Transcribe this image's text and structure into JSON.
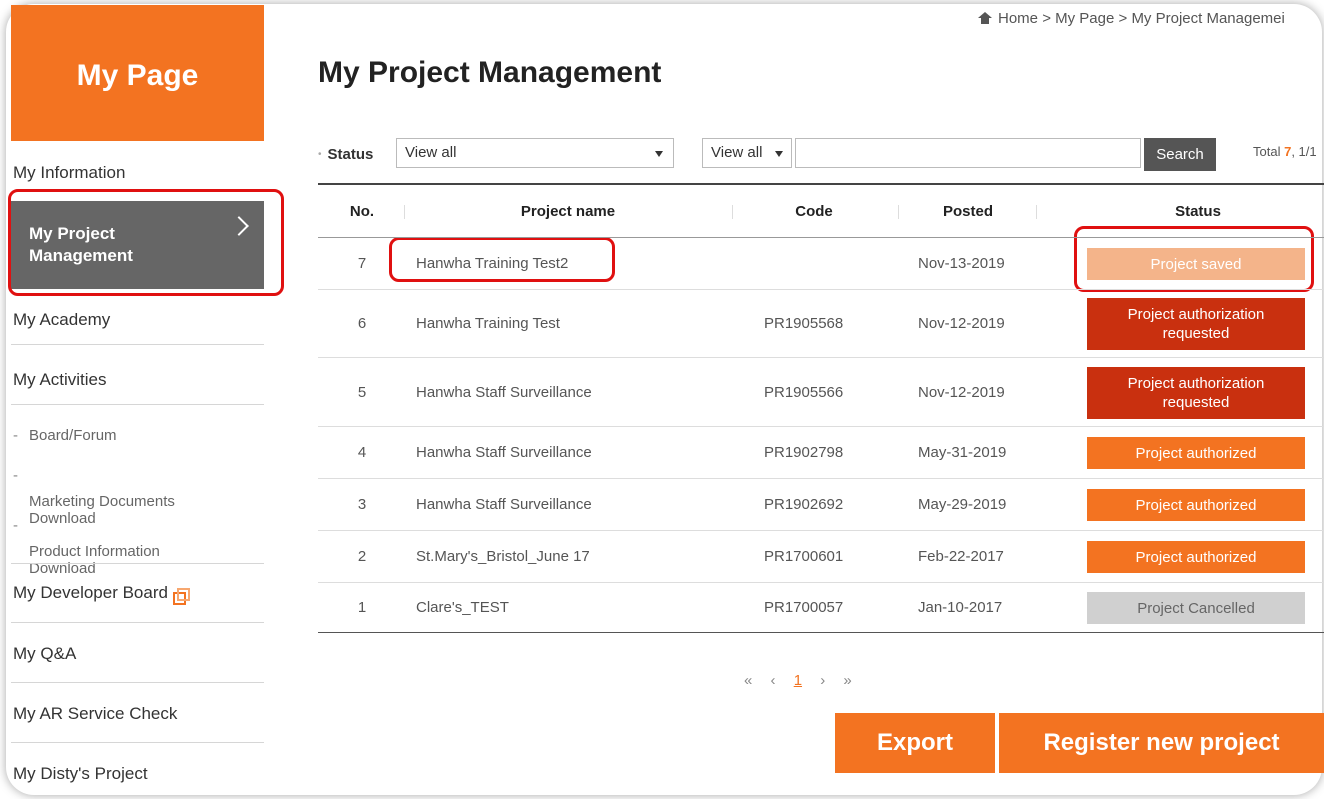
{
  "sidebar": {
    "header": "My Page",
    "items": [
      {
        "label": "My Information"
      },
      {
        "label": "My Project\nManagement"
      },
      {
        "label": "My Academy"
      },
      {
        "label": "My Activities"
      },
      {
        "label": "My Developer Board"
      },
      {
        "label": "My Q&A"
      },
      {
        "label": "My AR Service Check"
      },
      {
        "label": "My Disty's Project"
      }
    ],
    "sub_items": [
      {
        "label": "Board/Forum"
      },
      {
        "label": "Marketing Documents\nDownload"
      },
      {
        "label": "Product Information\nDownload"
      }
    ]
  },
  "breadcrumb": {
    "home": "Home",
    "sep": ">",
    "level1": "My Page",
    "level2": "My Project Managemei"
  },
  "page_title": "My Project Management",
  "filter": {
    "status_label": "Status",
    "status_value": "View all",
    "type_value": "View all",
    "search_value": "",
    "search_button": "Search",
    "total_prefix": "Total",
    "total_count": "7",
    "total_suffix": ", 1/1"
  },
  "table": {
    "headers": {
      "no": "No.",
      "name": "Project name",
      "code": "Code",
      "posted": "Posted",
      "status": "Status"
    },
    "rows": [
      {
        "no": "7",
        "name": "Hanwha Training Test2",
        "code": "",
        "posted": "Nov-13-2019",
        "status": "Project saved",
        "status_color": "#f4b48a"
      },
      {
        "no": "6",
        "name": "Hanwha Training Test",
        "code": "PR1905568",
        "posted": "Nov-12-2019",
        "status": "Project authorization requested",
        "status_color": "#c9300f"
      },
      {
        "no": "5",
        "name": "Hanwha Staff Surveillance",
        "code": "PR1905566",
        "posted": "Nov-12-2019",
        "status": "Project authorization requested",
        "status_color": "#c9300f"
      },
      {
        "no": "4",
        "name": "Hanwha Staff Surveillance",
        "code": "PR1902798",
        "posted": "May-31-2019",
        "status": "Project authorized",
        "status_color": "#f37321"
      },
      {
        "no": "3",
        "name": "Hanwha Staff Surveillance",
        "code": "PR1902692",
        "posted": "May-29-2019",
        "status": "Project authorized",
        "status_color": "#f37321"
      },
      {
        "no": "2",
        "name": "St.Mary's_Bristol_June 17",
        "code": "PR1700601",
        "posted": "Feb-22-2017",
        "status": "Project authorized",
        "status_color": "#f37321"
      },
      {
        "no": "1",
        "name": "Clare's_TEST",
        "code": "PR1700057",
        "posted": "Jan-10-2017",
        "status": "Project Cancelled",
        "status_color": "#d0d0d0",
        "status_text_color": "#666666"
      }
    ]
  },
  "pagination": {
    "first": "«",
    "prev": "‹",
    "current": "1",
    "next": "›",
    "last": "»"
  },
  "buttons": {
    "export": "Export",
    "register": "Register new project"
  },
  "colors": {
    "accent": "#f37321",
    "highlight": "#e01010",
    "active_nav": "#666666"
  }
}
